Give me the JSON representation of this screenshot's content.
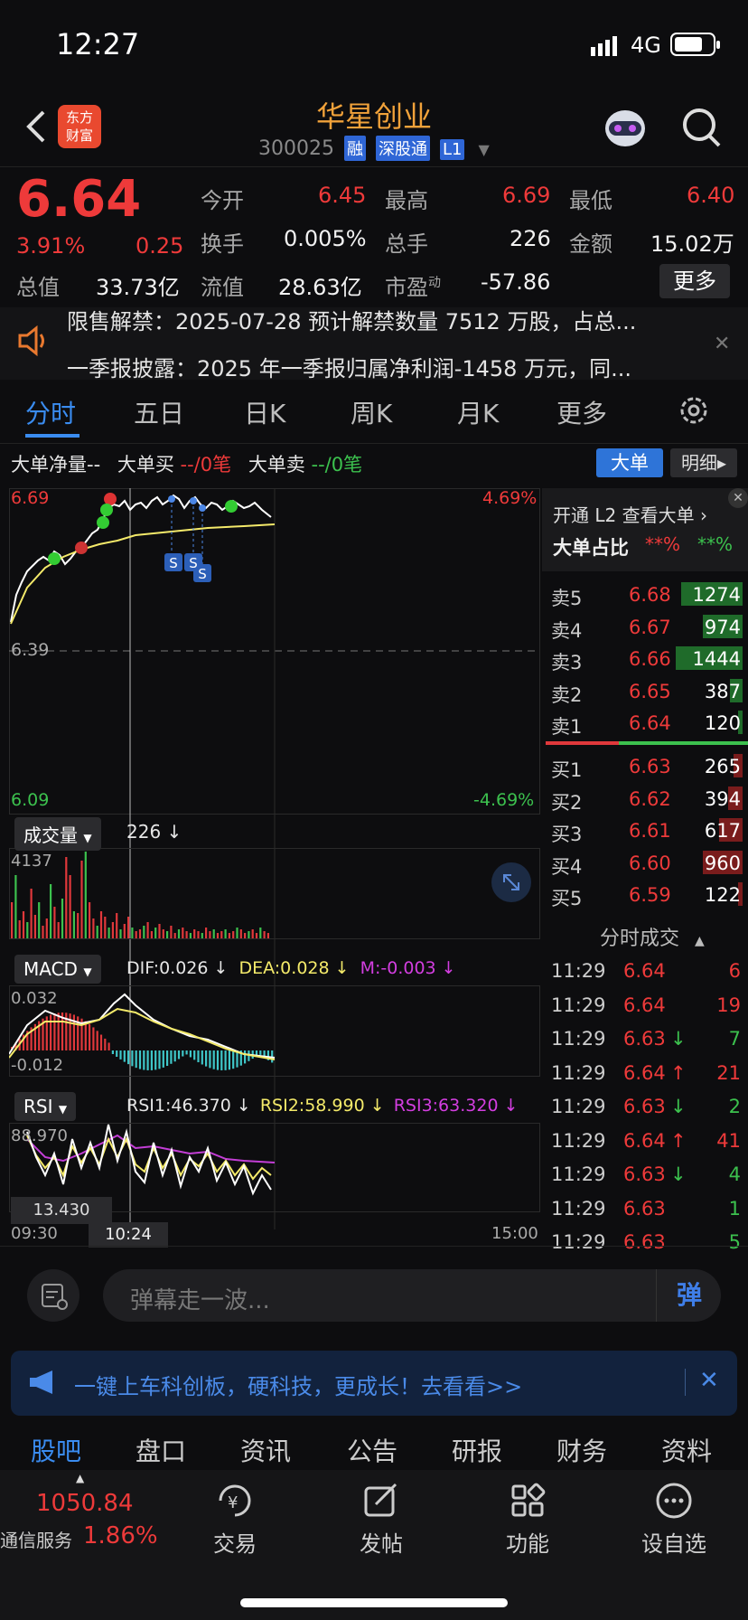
{
  "status_bar": {
    "time": "12:27",
    "network": "4G"
  },
  "header": {
    "logo_line1": "东方",
    "logo_line2": "财富",
    "name": "华星创业",
    "code": "300025",
    "tags": [
      "融",
      "深股通",
      "L1"
    ]
  },
  "quote": {
    "price": "6.64",
    "change_pct": "3.91%",
    "change": "0.25",
    "rows": [
      [
        {
          "label": "今开",
          "value": "6.45",
          "color": "red"
        },
        {
          "label": "最高",
          "value": "6.69",
          "color": "red"
        },
        {
          "label": "最低",
          "value": "6.40",
          "color": "red"
        }
      ],
      [
        {
          "label": "换手",
          "value": "0.005%",
          "color": "white"
        },
        {
          "label": "总手",
          "value": "226",
          "color": "white"
        },
        {
          "label": "金额",
          "value": "15.02万",
          "color": "white"
        }
      ],
      [
        {
          "label": "总值",
          "value": "33.73亿",
          "color": "white"
        },
        {
          "label": "流值",
          "value": "28.63亿",
          "color": "white"
        },
        {
          "label": "市盈",
          "label_sup": "动",
          "value": "-57.86",
          "color": "white"
        }
      ]
    ],
    "more_label": "更多"
  },
  "notice": {
    "line1": "限售解禁：2025-07-28 预计解禁数量 7512 万股，占总...",
    "line2": "一季报披露：2025 年一季报归属净利润-1458 万元，同..."
  },
  "tabs": [
    "分时",
    "五日",
    "日K",
    "周K",
    "月K",
    "更多"
  ],
  "big_order": {
    "net_label": "大单净量--",
    "buy_label": "大单买",
    "buy_value": "--/0笔",
    "sell_label": "大单卖",
    "sell_value": "--/0笔",
    "btn_big": "大单",
    "btn_detail": "明细"
  },
  "chart": {
    "high": "6.69",
    "high_pct": "4.69%",
    "mid": "6.39",
    "low": "6.09",
    "low_pct": "-4.69%",
    "vol_label": "成交量",
    "vol_value": "226",
    "vol_max": "4137",
    "macd_label": "MACD",
    "dif": "DIF:0.026",
    "dea": "DEA:0.028",
    "m": "M:-0.003",
    "macd_top": "0.032",
    "macd_bottom": "-0.012",
    "rsi_label": "RSI",
    "rsi1": "RSI1:46.370",
    "rsi2": "RSI2:58.990",
    "rsi3": "RSI3:63.320",
    "rsi_top": "88.970",
    "rsi_bottom": "13.430",
    "time_start": "09:30",
    "time_cursor": "10:24",
    "time_end": "15:00",
    "s_marker": "S"
  },
  "order_book": {
    "l2_label": "开通 L2 查看大单",
    "ratio_label": "大单占比",
    "ratio_buy": "**%",
    "ratio_sell": "**%",
    "asks": [
      {
        "label": "卖5",
        "price": "6.68",
        "vol": "1274",
        "fill": 0.85
      },
      {
        "label": "卖4",
        "price": "6.67",
        "vol": "974",
        "fill": 0.55
      },
      {
        "label": "卖3",
        "price": "6.66",
        "vol": "1444",
        "fill": 0.93
      },
      {
        "label": "卖2",
        "price": "6.65",
        "vol": "387",
        "fill": 0.18
      },
      {
        "label": "卖1",
        "price": "6.64",
        "vol": "120",
        "fill": 0.06
      }
    ],
    "bids": [
      {
        "label": "买1",
        "price": "6.63",
        "vol": "265",
        "fill": 0.12
      },
      {
        "label": "买2",
        "price": "6.62",
        "vol": "394",
        "fill": 0.2
      },
      {
        "label": "买3",
        "price": "6.61",
        "vol": "617",
        "fill": 0.32
      },
      {
        "label": "买4",
        "price": "6.60",
        "vol": "960",
        "fill": 0.55
      },
      {
        "label": "买5",
        "price": "6.59",
        "vol": "122",
        "fill": 0.06
      }
    ],
    "trades_label": "分时成交",
    "trades": [
      {
        "time": "11:29",
        "price": "6.64",
        "arrow": "",
        "vol": "6",
        "color": "red"
      },
      {
        "time": "11:29",
        "price": "6.64",
        "arrow": "",
        "vol": "19",
        "color": "red"
      },
      {
        "time": "11:29",
        "price": "6.63",
        "arrow": "↓",
        "vol": "7",
        "color": "green"
      },
      {
        "time": "11:29",
        "price": "6.64",
        "arrow": "↑",
        "vol": "21",
        "color": "red"
      },
      {
        "time": "11:29",
        "price": "6.63",
        "arrow": "↓",
        "vol": "2",
        "color": "green"
      },
      {
        "time": "11:29",
        "price": "6.64",
        "arrow": "↑",
        "vol": "41",
        "color": "red"
      },
      {
        "time": "11:29",
        "price": "6.63",
        "arrow": "↓",
        "vol": "4",
        "color": "green"
      },
      {
        "time": "11:29",
        "price": "6.63",
        "arrow": "",
        "vol": "1",
        "color": "green"
      },
      {
        "time": "11:29",
        "price": "6.63",
        "arrow": "",
        "vol": "5",
        "color": "green"
      }
    ]
  },
  "comment": {
    "placeholder": "弹幕走一波...",
    "send": "弹"
  },
  "banner": {
    "text": "一键上车科创板，硬科技，更成长！去看看>>"
  },
  "subtabs": [
    "股吧",
    "盘口",
    "资讯",
    "公告",
    "研报",
    "财务",
    "资料"
  ],
  "bottom_nav": {
    "index_value": "1050.84",
    "index_name": "通信服务",
    "index_pct": "1.86%",
    "items": [
      "交易",
      "发帖",
      "功能",
      "设自选"
    ]
  },
  "colors": {
    "up": "#ee3a3a",
    "down": "#3cc14e",
    "accent": "#3a8cf0",
    "brand": "#f1a23a"
  }
}
